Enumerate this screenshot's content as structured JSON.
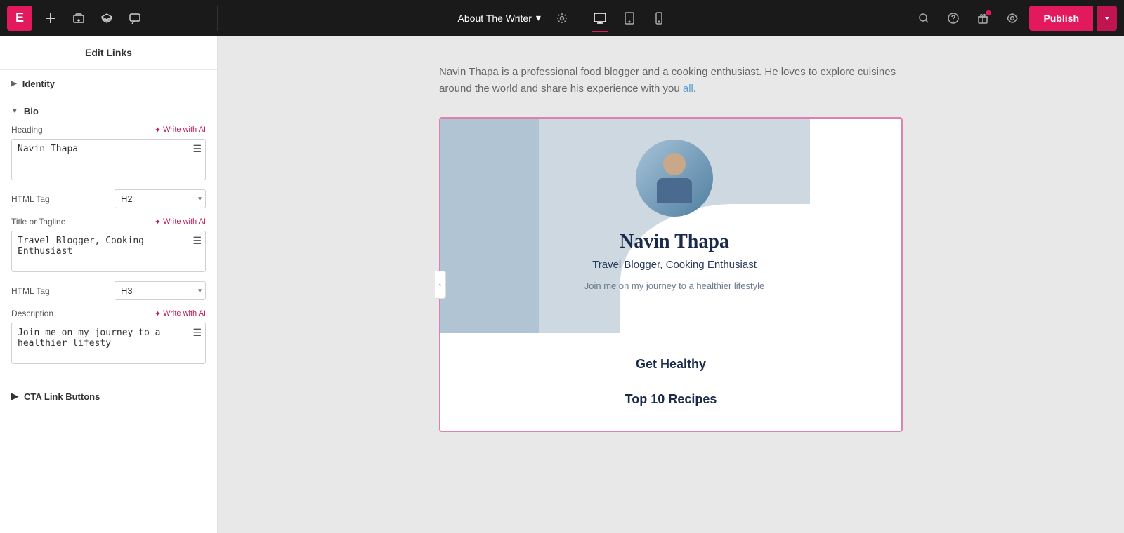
{
  "topbar": {
    "logo_label": "E",
    "page_title": "About The Writer",
    "chevron": "▾",
    "publish_label": "Publish",
    "views": [
      {
        "id": "desktop",
        "icon": "🖥",
        "active": true
      },
      {
        "id": "tablet",
        "icon": "⬜",
        "active": false
      },
      {
        "id": "mobile",
        "icon": "📱",
        "active": false
      }
    ]
  },
  "sidebar": {
    "header_label": "Edit Links",
    "identity_label": "Identity",
    "bio_label": "Bio",
    "bio_expanded": true,
    "heading_label": "Heading",
    "write_ai_label": "Write with AI",
    "heading_value": "Navin Thapa",
    "heading_html_tag_label": "HTML Tag",
    "heading_html_tag_value": "H2",
    "tagline_label": "Title or Tagline",
    "tagline_value": "Travel Blogger, Cooking Enthusiast",
    "tagline_html_tag_value": "H3",
    "description_label": "Description",
    "description_value": "Join me on my journey to a healthier lifesty",
    "cta_label": "CTA Link Buttons"
  },
  "canvas": {
    "description": "Navin Thapa is a professional food blogger and a cooking enthusiast. He loves to explore cuisines around the world and share his experience with you all.",
    "description_link_text": "all",
    "card": {
      "name": "Navin Thapa",
      "tagline": "Travel Blogger, Cooking Enthusiast",
      "join_text": "Join me on my journey to a healthier lifestyle",
      "links": [
        {
          "label": "Get Healthy"
        },
        {
          "label": "Top 10 Recipes"
        }
      ]
    }
  }
}
